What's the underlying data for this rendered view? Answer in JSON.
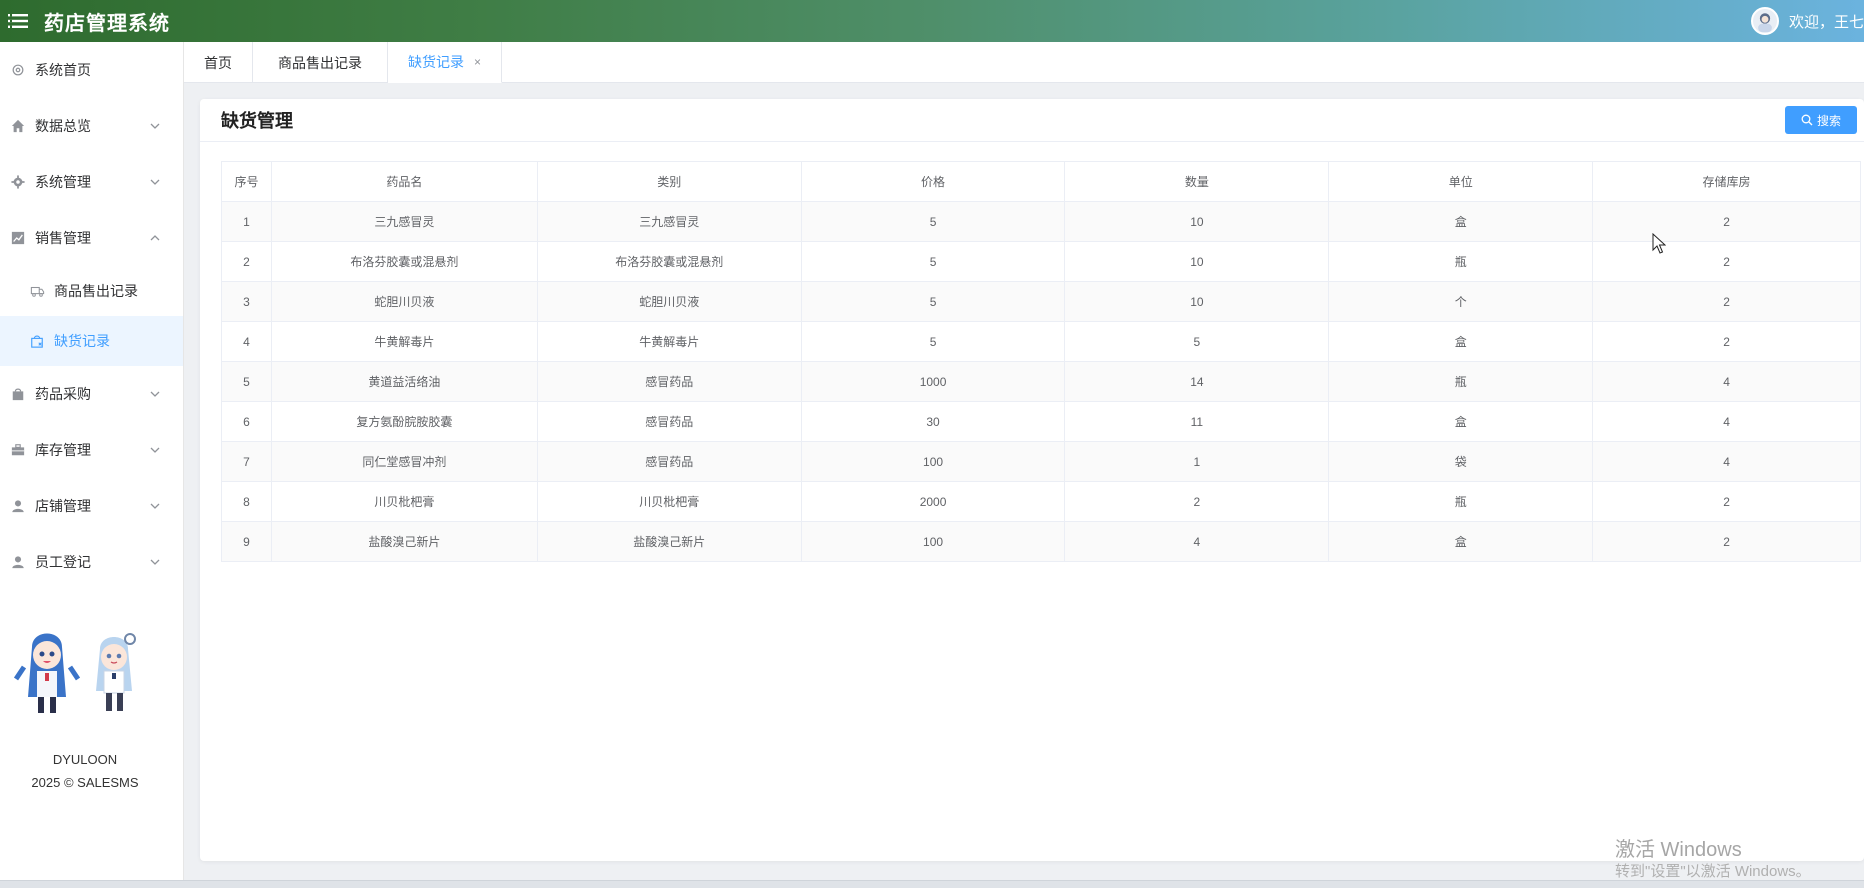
{
  "header": {
    "title": "药店管理系统",
    "welcome": "欢迎，王七"
  },
  "sidebar": {
    "items": [
      {
        "label": "系统首页",
        "icon": "gear-outline-icon"
      },
      {
        "label": "数据总览",
        "icon": "home-icon"
      },
      {
        "label": "系统管理",
        "icon": "gear-icon"
      },
      {
        "label": "销售管理",
        "icon": "chart-line-icon"
      },
      {
        "label": "商品售出记录",
        "icon": "truck-icon"
      },
      {
        "label": "缺货记录",
        "icon": "shopping-bag-icon"
      },
      {
        "label": "药品采购",
        "icon": "shopping-bag-filled-icon"
      },
      {
        "label": "库存管理",
        "icon": "briefcase-icon"
      },
      {
        "label": "店铺管理",
        "icon": "user-icon"
      },
      {
        "label": "员工登记",
        "icon": "user-icon"
      }
    ],
    "footer": {
      "line1": "DYULOON",
      "line2": "2025 © SALESMS"
    }
  },
  "tabs": [
    {
      "label": "首页"
    },
    {
      "label": "商品售出记录"
    },
    {
      "label": "缺货记录",
      "close": "×"
    }
  ],
  "card": {
    "title": "缺货管理",
    "search_label": "搜索"
  },
  "table": {
    "headers": [
      "序号",
      "药品名",
      "类别",
      "价格",
      "数量",
      "单位",
      "存储库房"
    ],
    "rows": [
      [
        "1",
        "三九感冒灵",
        "三九感冒灵",
        "5",
        "10",
        "盒",
        "2"
      ],
      [
        "2",
        "布洛芬胶囊或混悬剂",
        "布洛芬胶囊或混悬剂",
        "5",
        "10",
        "瓶",
        "2"
      ],
      [
        "3",
        "蛇胆川贝液",
        "蛇胆川贝液",
        "5",
        "10",
        "个",
        "2"
      ],
      [
        "4",
        "牛黄解毒片",
        "牛黄解毒片",
        "5",
        "5",
        "盒",
        "2"
      ],
      [
        "5",
        "黄道益活络油",
        "感冒药品",
        "1000",
        "14",
        "瓶",
        "4"
      ],
      [
        "6",
        "复方氨酚脘胺胶囊",
        "感冒药品",
        "30",
        "11",
        "盒",
        "4"
      ],
      [
        "7",
        "同仁堂感冒冲剂",
        "感冒药品",
        "100",
        "1",
        "袋",
        "4"
      ],
      [
        "8",
        "川贝枇杷膏",
        "川贝枇杷膏",
        "2000",
        "2",
        "瓶",
        "2"
      ],
      [
        "9",
        "盐酸溴己新片",
        "盐酸溴己新片",
        "100",
        "4",
        "盒",
        "2"
      ]
    ]
  },
  "watermark": {
    "line1": "激活 Windows",
    "line2": "转到\"设置\"以激活 Windows。"
  },
  "colors": {
    "accent": "#409eff",
    "active_bg": "#ecf5ff"
  }
}
